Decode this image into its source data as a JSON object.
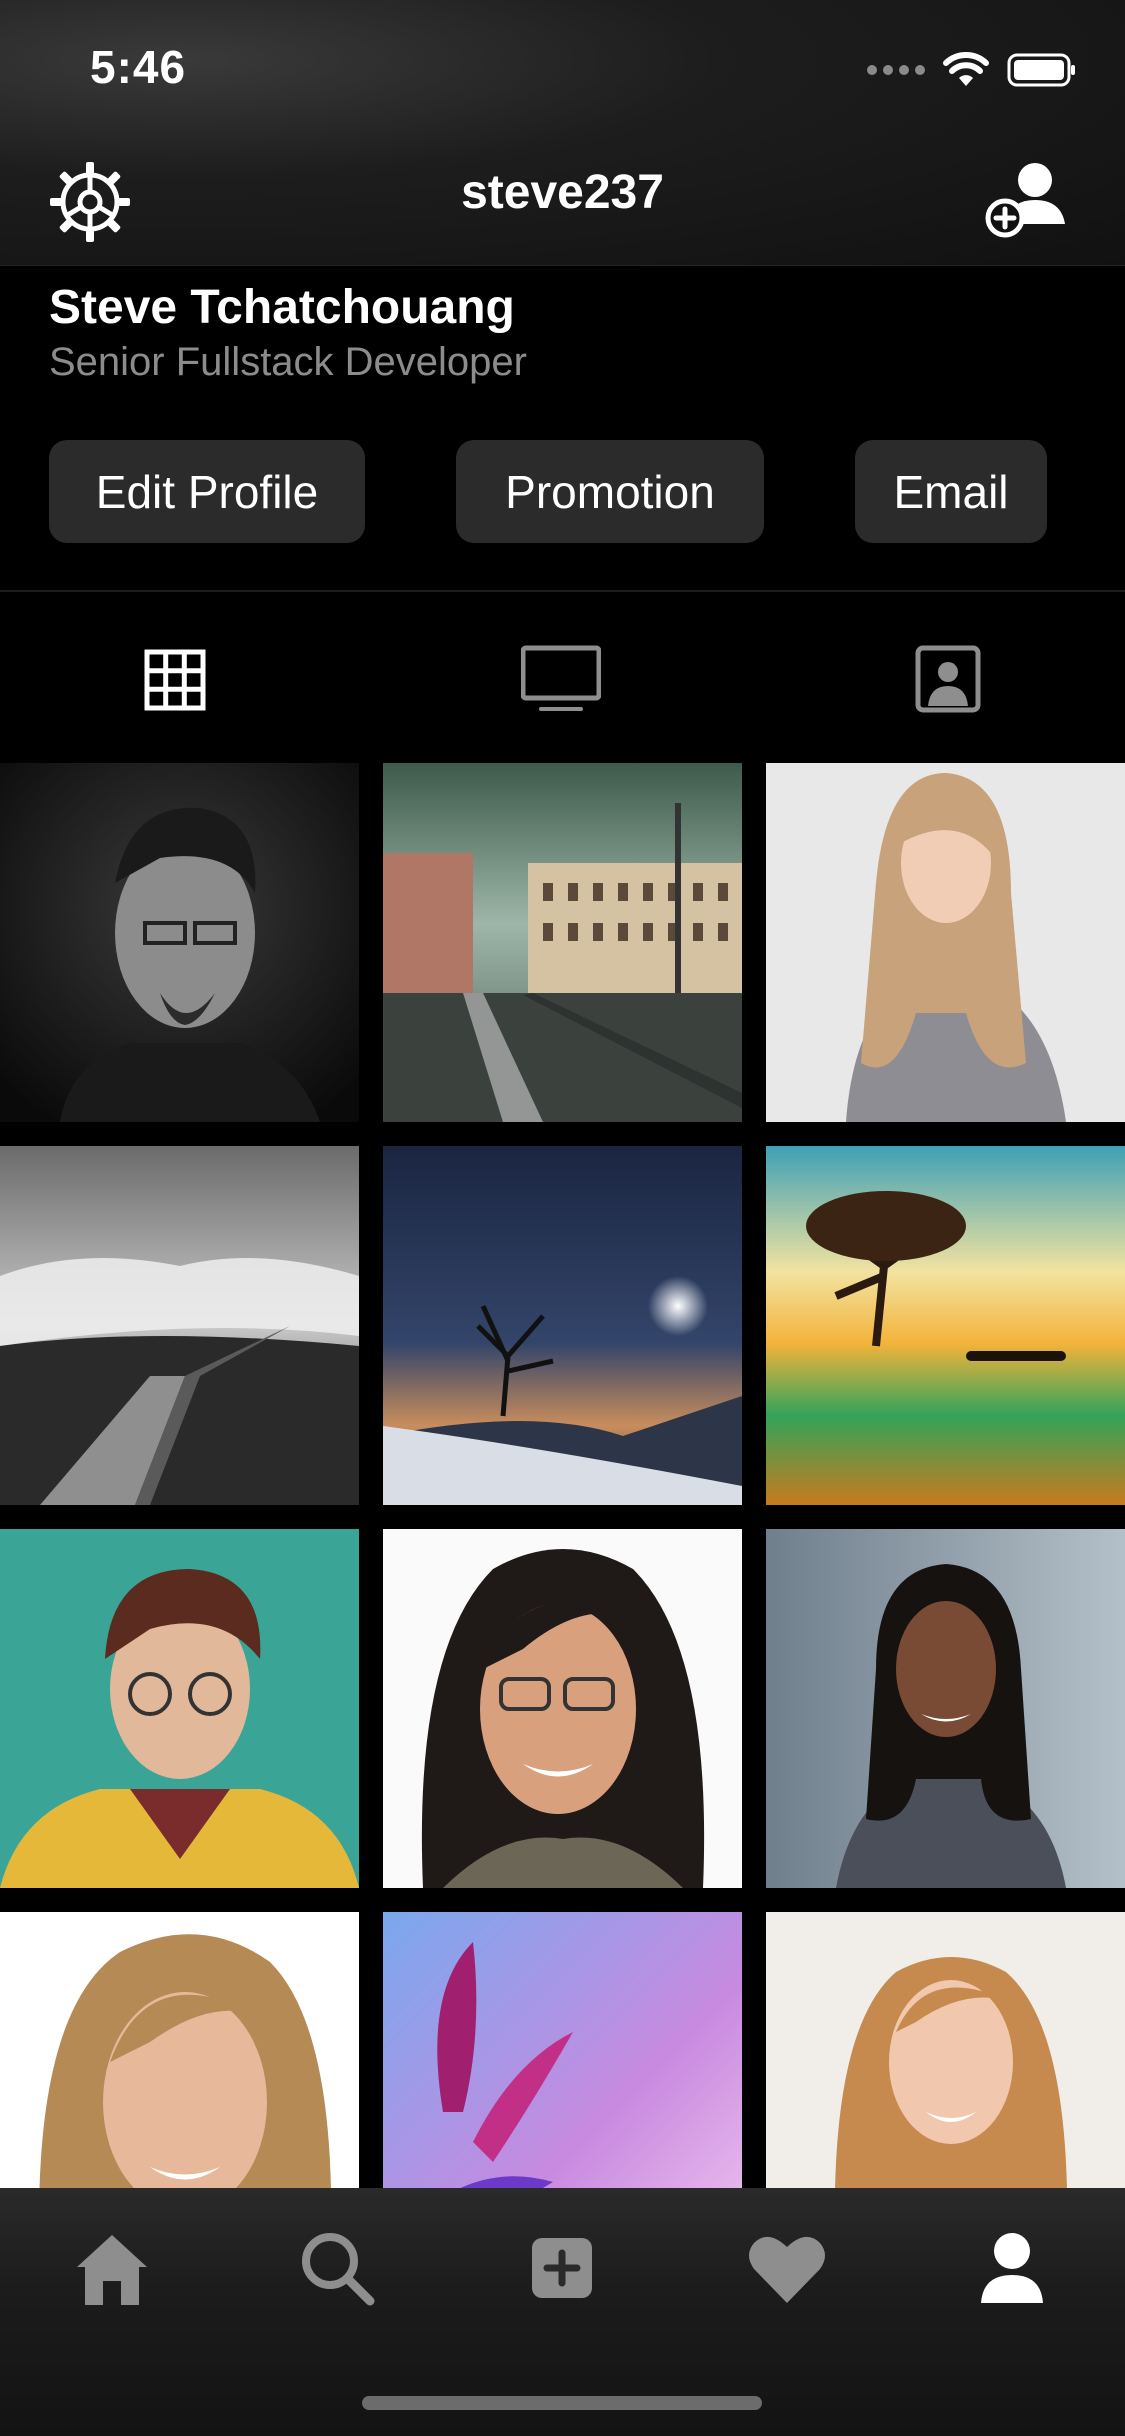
{
  "status_bar": {
    "time": "5:46",
    "icons": [
      "signal-icon",
      "wifi-icon",
      "battery-icon"
    ]
  },
  "nav": {
    "title": "steve237",
    "left_icon": "gear-icon",
    "right_icon": "add-user-icon"
  },
  "profile": {
    "name": "Steve Tchatchouang",
    "role": "Senior Fullstack Developer"
  },
  "actions": {
    "edit_label": "Edit Profile",
    "promotion_label": "Promotion",
    "email_label": "Email"
  },
  "profile_tabs": [
    {
      "icon": "grid-icon",
      "active": true
    },
    {
      "icon": "tv-icon",
      "active": false
    },
    {
      "icon": "tagged-portrait-icon",
      "active": false
    }
  ],
  "photos": [
    "man-glasses-bw-portrait",
    "city-square-street",
    "woman-long-blonde-hair",
    "boardwalk-clouds-bw",
    "night-sky-tree",
    "tree-in-water-sunset",
    "illustrated-man-glasses",
    "woman-glasses-smiling",
    "woman-dark-hair-office",
    "woman-blonde-headshot",
    "purple-flowers",
    "woman-red-hair-smiling"
  ],
  "bottom_tabs": [
    {
      "icon": "home-icon"
    },
    {
      "icon": "search-icon"
    },
    {
      "icon": "add-post-icon"
    },
    {
      "icon": "heart-icon"
    },
    {
      "icon": "profile-icon",
      "active": true
    }
  ],
  "colors": {
    "background": "#000000",
    "button_bg": "#2b2b2b",
    "secondary_text": "#8c8c8c",
    "inactive_icon": "#8e8e8e"
  }
}
